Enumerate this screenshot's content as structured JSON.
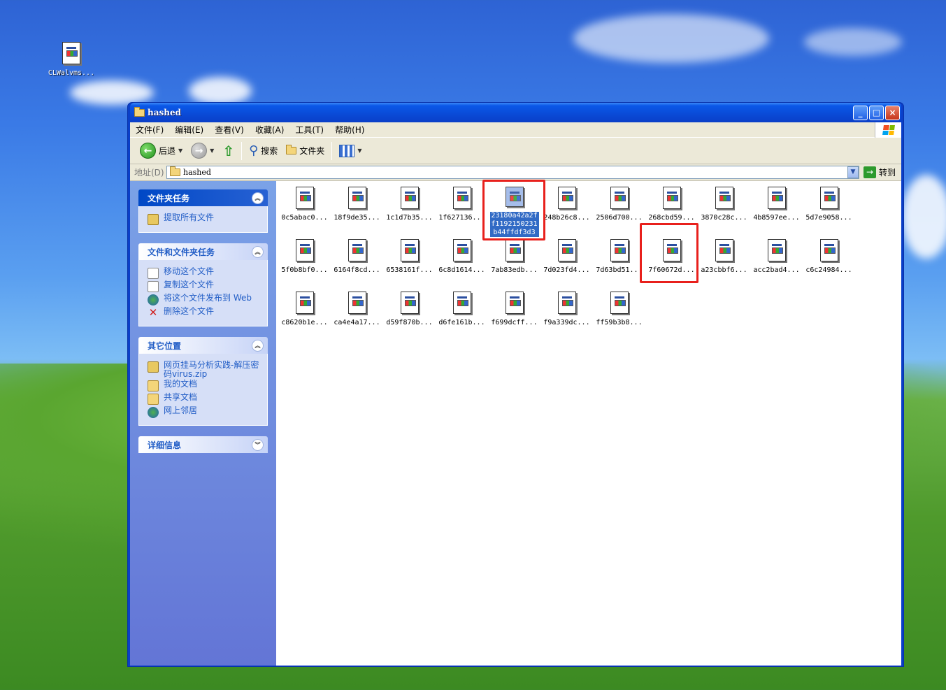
{
  "desktop": {
    "icon_label": "CLWalvms..."
  },
  "window": {
    "title": "hashed",
    "buttons": {
      "minimize": "_",
      "maximize": "□",
      "close": "×"
    }
  },
  "menu": [
    "文件(F)",
    "编辑(E)",
    "查看(V)",
    "收藏(A)",
    "工具(T)",
    "帮助(H)"
  ],
  "toolbar": {
    "back": "后退",
    "search": "搜索",
    "folders": "文件夹"
  },
  "address": {
    "label": "地址(D)",
    "value": "hashed",
    "go": "转到"
  },
  "sidebar": {
    "file_tasks": {
      "title": "文件夹任务",
      "items": [
        "提取所有文件"
      ]
    },
    "file_folder_tasks": {
      "title": "文件和文件夹任务",
      "items": [
        "移动这个文件",
        "复制这个文件",
        "将这个文件发布到 Web",
        "删除这个文件"
      ]
    },
    "other_places": {
      "title": "其它位置",
      "items": [
        "网页挂马分析实践-解压密码virus.zip",
        "我的文档",
        "共享文档",
        "网上邻居"
      ]
    },
    "details": {
      "title": "详细信息"
    }
  },
  "files": [
    "0c5abac0...",
    "18f9de35...",
    "1c1d7b35...",
    "1f627136...",
    "23180a42a2ff1192150231b44ffdf3d3",
    "248b26c8...",
    "2506d700...",
    "268cbd59...",
    "3870c28c...",
    "4b8597ee...",
    "5d7e9058...",
    "5f0b8bf0...",
    "6164f8cd...",
    "6538161f...",
    "6c8d1614...",
    "7ab83edb...",
    "7d023fd4...",
    "7d63bd51...",
    "7f60672d...",
    "a23cbbf6...",
    "acc2bad4...",
    "c6c24984...",
    "c8620b1e...",
    "ca4e4a17...",
    "d59f870b...",
    "d6fe161b...",
    "f699dcff...",
    "f9a339dc...",
    "ff59b3b8..."
  ],
  "selected_index": 4,
  "colors": {
    "highlight": "#e8201c",
    "selection": "#316ac5",
    "xp_blue": "#0a4ad6"
  }
}
